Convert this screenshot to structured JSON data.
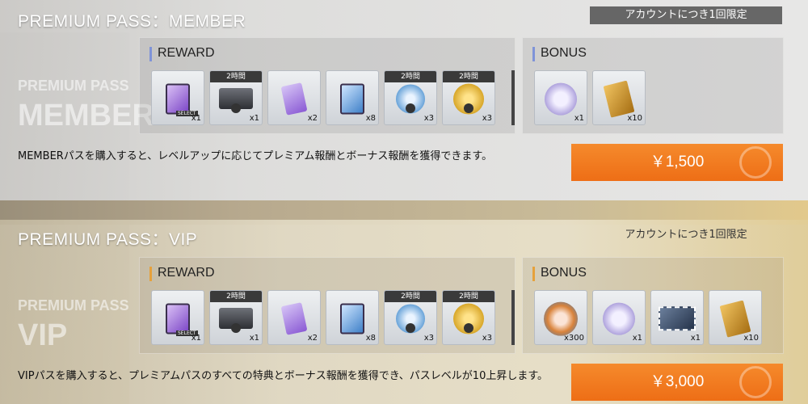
{
  "member": {
    "title": "PREMIUM PASS：MEMBER",
    "limit": "アカウントにつき1回限定",
    "watermark_top": "PREMIUM PASS",
    "watermark_bottom": "MEMBER",
    "reward_label": "REWARD",
    "bonus_label": "BONUS",
    "rewards": [
      {
        "icon": "purple-card-icon",
        "tag": "",
        "qty": "x1",
        "select": "SELECT"
      },
      {
        "icon": "chest-icon",
        "tag": "2時間",
        "qty": "x1"
      },
      {
        "icon": "purple-ticket-icon",
        "tag": "",
        "qty": "x2"
      },
      {
        "icon": "blue-card-icon",
        "tag": "",
        "qty": "x8"
      },
      {
        "icon": "disc-icon",
        "tag": "2時間",
        "qty": "x3"
      },
      {
        "icon": "gold-coin-icon",
        "tag": "2時間",
        "qty": "x3"
      }
    ],
    "bonuses": [
      {
        "icon": "pouch-icon",
        "qty": "x1"
      },
      {
        "icon": "gold-book-icon",
        "qty": "x10"
      }
    ],
    "description": "MEMBERパスを購入すると、レベルアップに応じてプレミアム報酬とボーナス報酬を獲得できます。",
    "price": "￥1,500"
  },
  "vip": {
    "title": "PREMIUM PASS：VIP",
    "limit": "アカウントにつき1回限定",
    "watermark_top": "PREMIUM PASS",
    "watermark_bottom": "VIP",
    "reward_label": "REWARD",
    "bonus_label": "BONUS",
    "rewards": [
      {
        "icon": "purple-card-icon",
        "tag": "",
        "qty": "x1",
        "select": "SELECT"
      },
      {
        "icon": "chest-icon",
        "tag": "2時間",
        "qty": "x1"
      },
      {
        "icon": "purple-ticket-icon",
        "tag": "",
        "qty": "x2"
      },
      {
        "icon": "blue-card-icon",
        "tag": "",
        "qty": "x8"
      },
      {
        "icon": "disc-icon",
        "tag": "2時間",
        "qty": "x3"
      },
      {
        "icon": "gold-coin-icon",
        "tag": "2時間",
        "qty": "x3"
      }
    ],
    "bonuses": [
      {
        "icon": "gear-orb-icon",
        "qty": "x300"
      },
      {
        "icon": "pouch-icon",
        "qty": "x1"
      },
      {
        "icon": "film-icon",
        "qty": "x1"
      },
      {
        "icon": "gold-book-icon",
        "qty": "x10"
      }
    ],
    "description": "VIPパスを購入すると、プレミアムパスのすべての特典とボーナス報酬を獲得でき、パスレベルが10上昇します。",
    "price": "￥3,000"
  },
  "colors": {
    "button": "#f07a1f",
    "reward_accent_member": "#7f93d8",
    "reward_accent_vip": "#e6a13b"
  }
}
